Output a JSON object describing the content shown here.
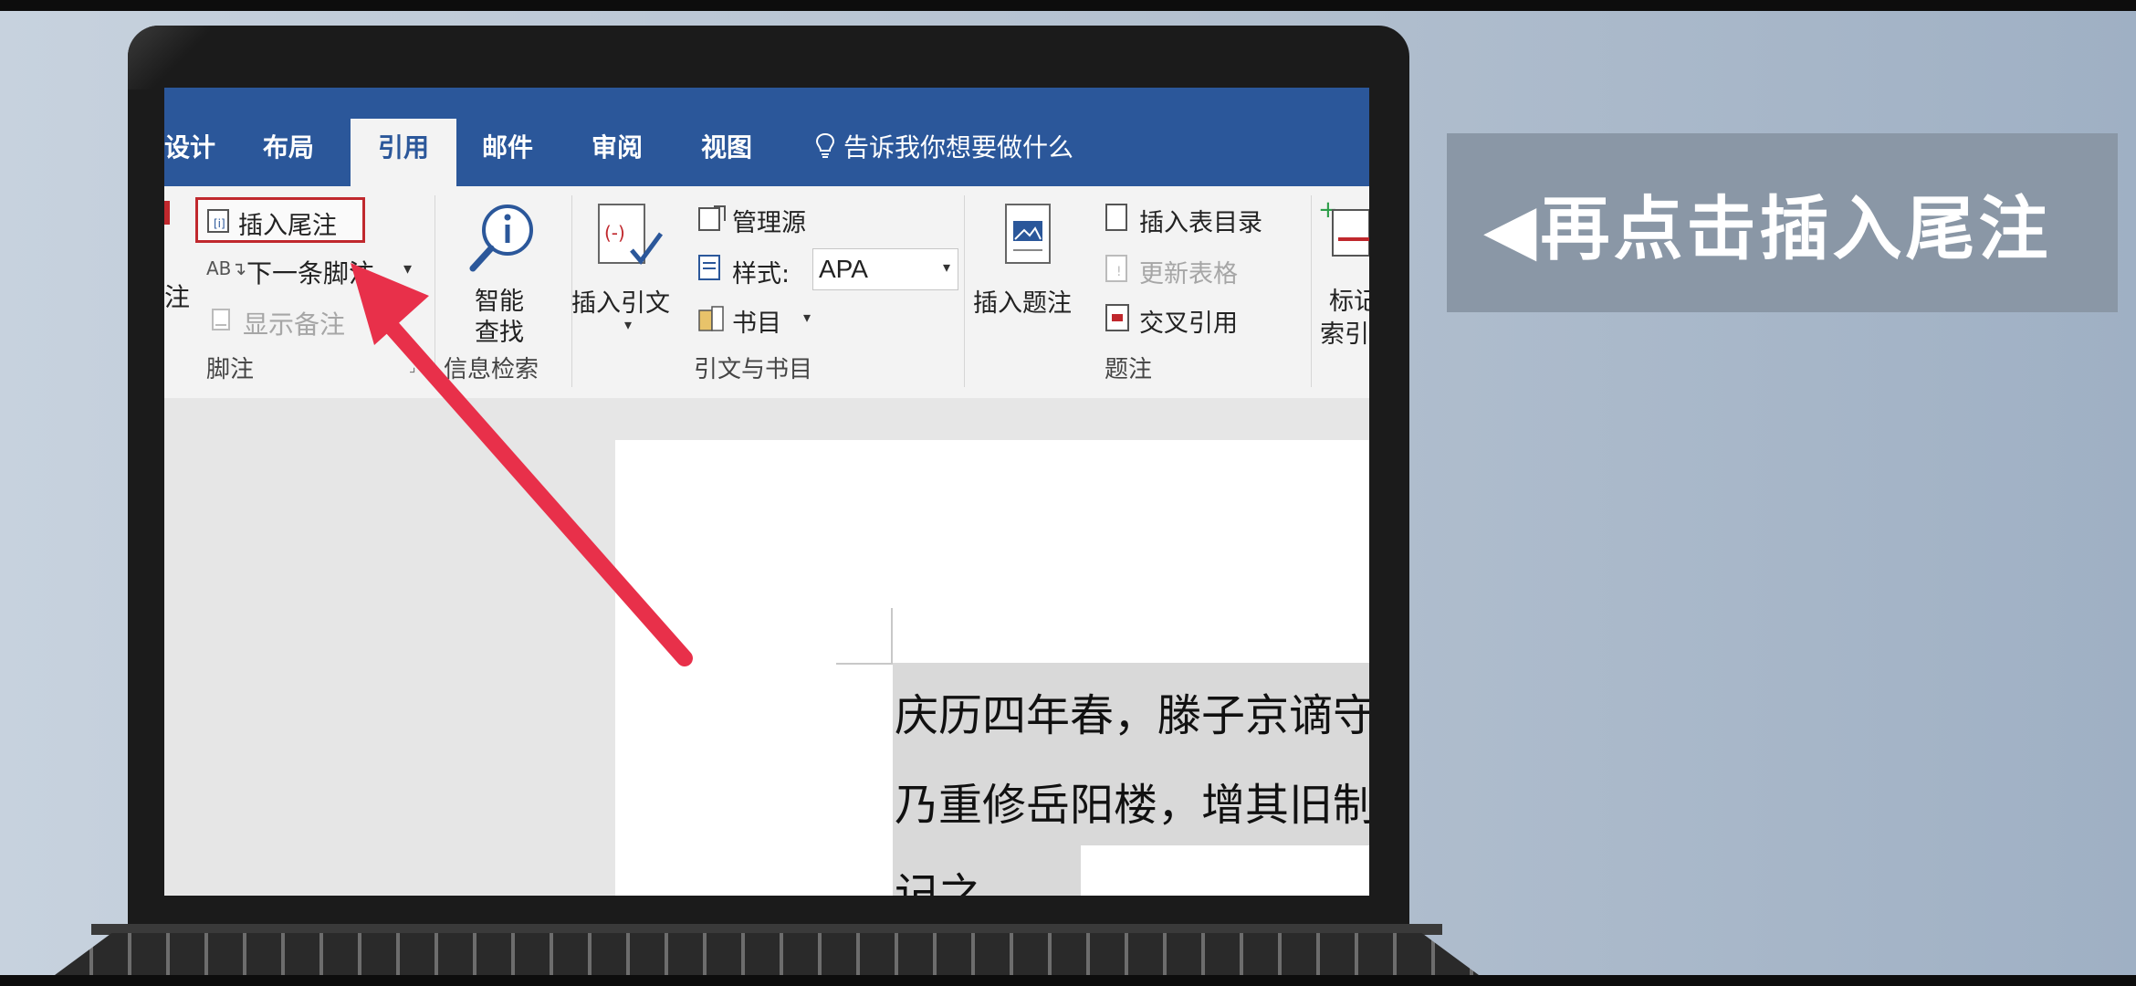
{
  "ribbon_tabs": {
    "design": "设计",
    "layout": "布局",
    "references": "引用",
    "mailings": "邮件",
    "review": "审阅",
    "view": "视图",
    "tell_me": "告诉我你想要做什么"
  },
  "footnotes_group": {
    "insert_endnote": "插入尾注",
    "next_footnote": "下一条脚注",
    "show_notes": "显示备注",
    "partial_label": "注",
    "group_label": "脚注"
  },
  "research_group": {
    "smart_lookup_1": "智能",
    "smart_lookup_2": "查找",
    "group_label": "信息检索"
  },
  "citations_group": {
    "insert_citation": "插入引文",
    "manage_sources": "管理源",
    "style_label": "样式:",
    "style_value": "APA",
    "bibliography": "书目",
    "group_label": "引文与书目"
  },
  "captions_group": {
    "insert_caption": "插入题注",
    "insert_table_of_figures": "插入表目录",
    "update_table": "更新表格",
    "cross_reference": "交叉引用",
    "group_label": "题注"
  },
  "index_group": {
    "mark_entry_1": "标记",
    "mark_entry_2": "索引"
  },
  "document": {
    "line1": "庆历四年春，滕子京谪守",
    "line2": "乃重修岳阳楼，增其旧制",
    "line3": "记之"
  },
  "overlay": {
    "caption": "◀再点击插入尾注",
    "arrow_color": "#e8304a",
    "highlight_color": "#c0282d"
  },
  "colors": {
    "ribbon_blue": "#2b579a"
  }
}
